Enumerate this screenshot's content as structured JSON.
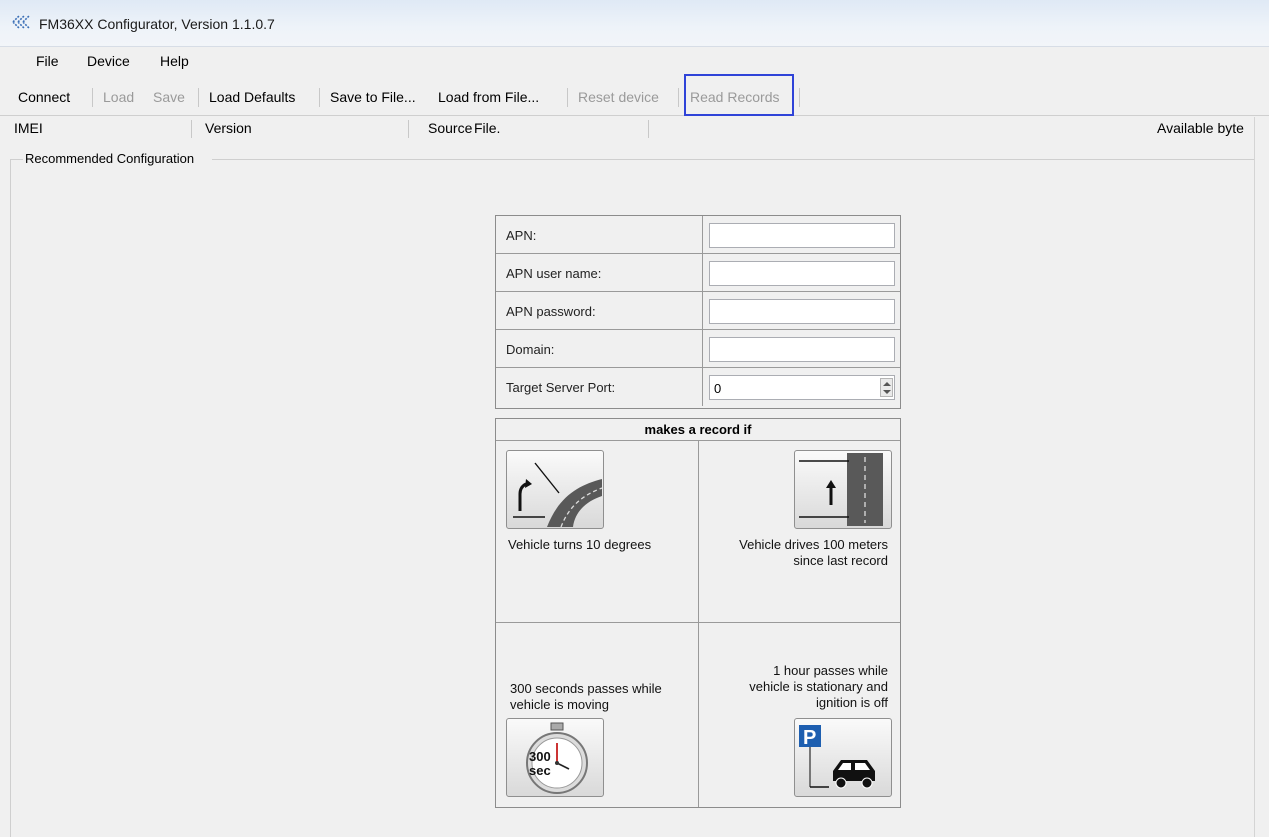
{
  "window": {
    "title": "FM36XX Configurator, Version 1.1.0.7"
  },
  "menu": {
    "file": "File",
    "device": "Device",
    "help": "Help"
  },
  "toolbar": {
    "connect": "Connect",
    "load": "Load",
    "save": "Save",
    "load_defaults": "Load Defaults",
    "save_to_file": "Save to File...",
    "load_from_file": "Load from File...",
    "reset_device": "Reset device",
    "read_records": "Read Records"
  },
  "info": {
    "imei": "IMEI",
    "version": "Version",
    "source_label": "Source",
    "source_value": "File.",
    "available": "Available byte"
  },
  "group": {
    "label": "Recommended Configuration"
  },
  "form": {
    "apn_label": "APN:",
    "apn_value": "",
    "apn_user_label": "APN user name:",
    "apn_user_value": "",
    "apn_password_label": "APN password:",
    "apn_password_value": "",
    "domain_label": "Domain:",
    "domain_value": "",
    "port_label": "Target Server Port:",
    "port_value": "0"
  },
  "record": {
    "title": "makes a record if",
    "turn_text": "Vehicle turns 10 degrees",
    "distance_text_1": "Vehicle drives 100 meters",
    "distance_text_2": "since last record",
    "time_text_1": "300 seconds passes while",
    "time_text_2": "vehicle is moving",
    "stationary_text_1": "1 hour passes while",
    "stationary_text_2": "vehicle is stationary and",
    "stationary_text_3": "ignition is off",
    "timer_label_1": "300",
    "timer_label_2": "sec",
    "parking_letter": "P"
  },
  "colors": {
    "highlight_box": "#2f43d8",
    "background": "#f0f0f0"
  }
}
